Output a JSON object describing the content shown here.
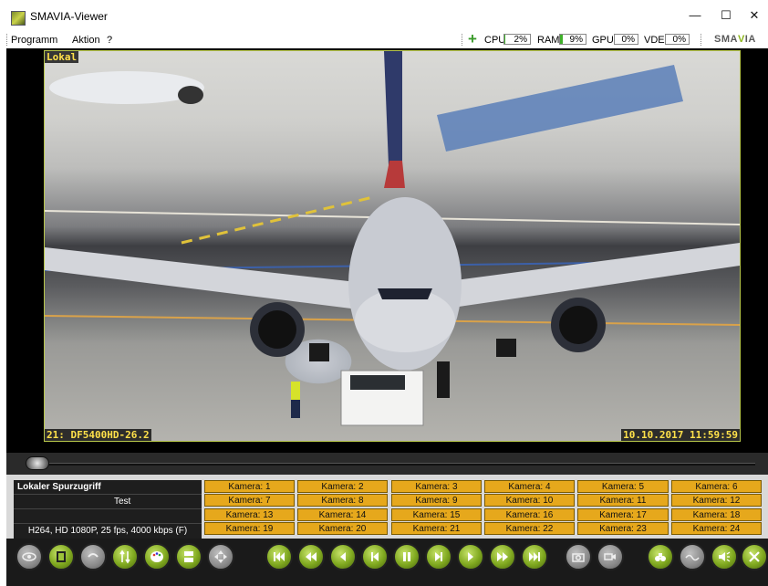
{
  "window": {
    "title": "SMAVIA-Viewer",
    "minimize": "—",
    "maximize": "☐",
    "close": "✕"
  },
  "menu": {
    "items": [
      "Programm",
      "Aktion",
      "?"
    ]
  },
  "stats": {
    "cpu_label": "CPU",
    "cpu_value": "2%",
    "cpu_fraction": 0.02,
    "ram_label": "RAM",
    "ram_value": "9%",
    "ram_fraction": 0.09,
    "gpu_label": "GPU",
    "gpu_value": "0%",
    "gpu_fraction": 0.0,
    "vde_label": "VDE",
    "vde_value": "0%",
    "vde_fraction": 0.0
  },
  "logo": {
    "left": "SMA",
    "mid": "V",
    "right": "IA"
  },
  "video": {
    "mode": "Lokal",
    "camera_label": "21: DF5400HD-26.2",
    "timestamp": "10.10.2017  11:59:59"
  },
  "playback": {
    "position_fraction": 0.0
  },
  "info": {
    "title": "Lokaler Spurzugriff",
    "name": "Test",
    "stream": "H264, HD 1080P, 25 fps, 4000 kbps (F)"
  },
  "cameras": [
    "Kamera: 1",
    "Kamera: 2",
    "Kamera: 3",
    "Kamera: 4",
    "Kamera: 5",
    "Kamera: 6",
    "Kamera: 7",
    "Kamera: 8",
    "Kamera: 9",
    "Kamera: 10",
    "Kamera: 11",
    "Kamera: 12",
    "Kamera: 13",
    "Kamera: 14",
    "Kamera: 15",
    "Kamera: 16",
    "Kamera: 17",
    "Kamera: 18",
    "Kamera: 19",
    "Kamera: 20",
    "Kamera: 21",
    "Kamera: 22",
    "Kamera: 23",
    "Kamera: 24"
  ],
  "colors": {
    "accent": "#8cb51a",
    "camera_button": "#e6a81c",
    "overlay_text": "#ffe14a"
  }
}
